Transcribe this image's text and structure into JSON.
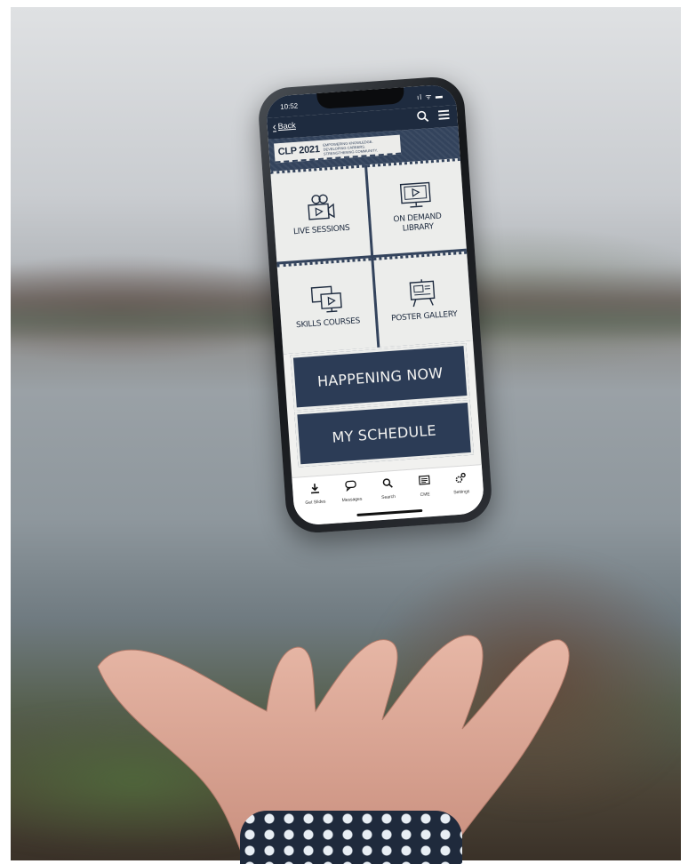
{
  "status": {
    "time": "10:52",
    "signal_icons": "ıl ᯤ ▬"
  },
  "nav": {
    "back_label": "Back"
  },
  "banner": {
    "title": "CLP 2021",
    "tagline": "Empowering Knowledge. Developing Careers. Strengthening Community."
  },
  "tiles": [
    {
      "label": "LIVE SESSIONS",
      "icon": "video-camera-icon"
    },
    {
      "label": "ON DEMAND LIBRARY",
      "icon": "monitor-play-icon"
    },
    {
      "label": "SKILLS COURSES",
      "icon": "screens-play-icon"
    },
    {
      "label": "POSTER GALLERY",
      "icon": "easel-poster-icon"
    }
  ],
  "buttons": {
    "happening_now": "HAPPENING NOW",
    "my_schedule": "MY SCHEDULE"
  },
  "tabbar": {
    "items": [
      {
        "label": "Get Slides",
        "icon": "download-icon"
      },
      {
        "label": "Messages",
        "icon": "chat-icon"
      },
      {
        "label": "Search",
        "icon": "search-icon"
      },
      {
        "label": "CME",
        "icon": "certificate-icon"
      },
      {
        "label": "Settings",
        "icon": "gear-icon"
      }
    ]
  },
  "colors": {
    "navy": "#1e2b3f",
    "button_navy": "#2c3c56",
    "tile_bg": "#ecedeb"
  }
}
